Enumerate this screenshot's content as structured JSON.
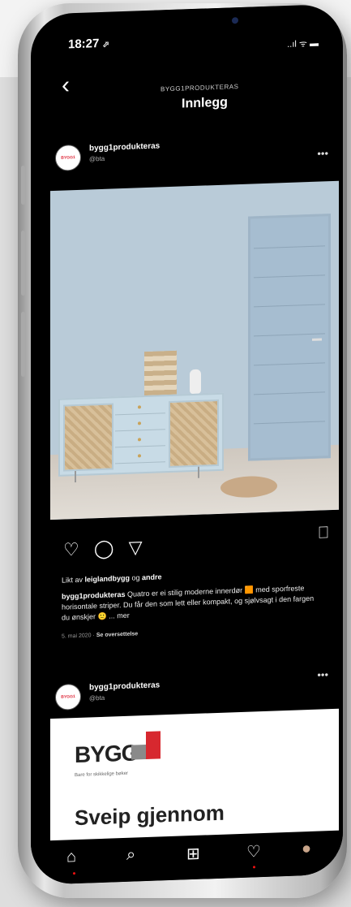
{
  "status": {
    "time": "18:27",
    "time_arrow": "⬀",
    "icons": "..ıl ᯤ ▬"
  },
  "header": {
    "back_icon": "‹",
    "account": "BYGG1PRODUKTERAS",
    "title": "Innlegg"
  },
  "post1": {
    "username": "bygg1produkteras",
    "subtitle": "@bta",
    "more": "•••",
    "likes_prefix": "Likt av ",
    "liked_by": "leiglandbygg",
    "likes_mid": " og ",
    "likes_others": "andre",
    "caption_user": "bygg1produkteras",
    "caption_text": " Quatro er ei stilig moderne innerdør 🟧 med sporfreste horisontale striper. Du får den som lett eller kompakt, og sjølvsagt i den fargen du ønskjer 🙂 ... mer",
    "date": "5. mai 2020",
    "translate": "Se oversettelse"
  },
  "post2": {
    "username": "bygg1produkteras",
    "subtitle": "@bta",
    "more": "•••",
    "logo_text": "BYGG",
    "logo_sub": "Bare for skikkelige bøker",
    "headline": "Sveip gjennom"
  },
  "avatar_text": "BYGG1",
  "tabs": {
    "home": "⌂",
    "search": "⌕",
    "add": "⊞",
    "heart": "♡",
    "profile": "●"
  },
  "actions": {
    "like": "♡",
    "comment": "◯",
    "share": "▽",
    "bookmark": "⎕"
  }
}
